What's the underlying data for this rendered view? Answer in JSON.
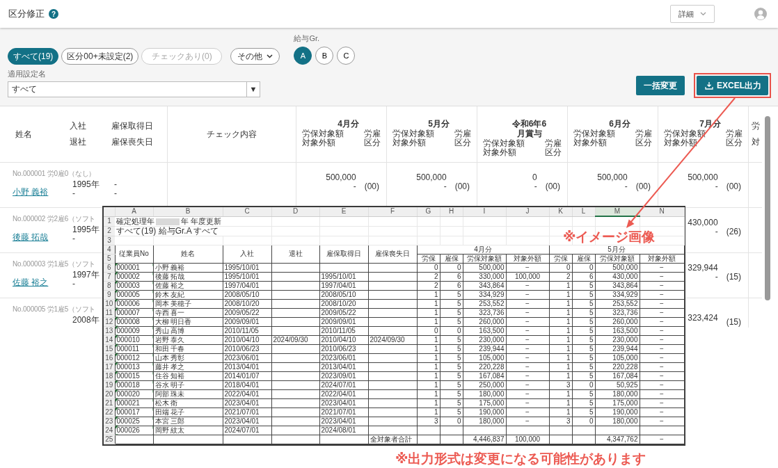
{
  "header": {
    "title": "区分修正",
    "help_icon": "?",
    "detail_menu": "詳細"
  },
  "filters": {
    "chips": [
      {
        "label": "すべて(19)",
        "selected": true,
        "disabled": false
      },
      {
        "label": "区分00+未設定(2)",
        "selected": false,
        "disabled": false
      },
      {
        "label": "チェックあり(0)",
        "selected": false,
        "disabled": true
      }
    ],
    "other_menu": "その他",
    "group_label": "給与Gr.",
    "groups": [
      {
        "label": "A",
        "selected": true
      },
      {
        "label": "B",
        "selected": false
      },
      {
        "label": "C",
        "selected": false
      }
    ]
  },
  "setting": {
    "label": "適用設定名",
    "value": "すべて",
    "arrow": "▼"
  },
  "actions": [
    {
      "label": "一括変更",
      "highlighted": false
    },
    {
      "label": "EXCEL出力",
      "highlighted": true
    }
  ],
  "table": {
    "columns": [
      {
        "kind": "plain",
        "lines": [
          "姓名"
        ]
      },
      {
        "kind": "plain",
        "lines": [
          "入社",
          "退社"
        ]
      },
      {
        "kind": "plain",
        "lines": [
          "雇保取得日",
          "雇保喪失日"
        ]
      },
      {
        "kind": "center",
        "lines": [
          "チェック内容"
        ]
      },
      {
        "kind": "month",
        "lines": [
          "4月分"
        ],
        "left": [
          "労保対象額",
          "対象外額"
        ],
        "right": [
          "労雇",
          "区分"
        ]
      },
      {
        "kind": "month",
        "lines": [
          "5月分"
        ],
        "left": [
          "労保対象額",
          "対象外額"
        ],
        "right": [
          "労雇",
          "区分"
        ]
      },
      {
        "kind": "month",
        "lines": [
          "令和6年6",
          "月賞与"
        ],
        "left": [
          "労保対象額",
          "対象外額"
        ],
        "right": [
          "労雇",
          "区分"
        ]
      },
      {
        "kind": "month",
        "lines": [
          "6月分"
        ],
        "left": [
          "労保対象額",
          "対象外額"
        ],
        "right": [
          "労雇",
          "区分"
        ]
      },
      {
        "kind": "month",
        "lines": [
          "7月分"
        ],
        "left": [
          "労保対象額",
          "対象外額"
        ],
        "right": [
          "労雇",
          "区分"
        ]
      },
      {
        "kind": "partial",
        "lines": [
          "労",
          "対"
        ]
      }
    ],
    "rows": [
      {
        "kind": "full",
        "number": "No.000001 労0雇0（なし）",
        "name": "小野 義裕",
        "joined": [
          "1995年",
          "-"
        ],
        "insured": [
          "-",
          "-"
        ],
        "months": [
          {
            "amount": "500,000",
            "excluded": "-",
            "code": "(00)"
          },
          {
            "amount": "500,000",
            "excluded": "-",
            "code": "(00)"
          },
          {
            "amount": "0",
            "excluded": "-",
            "code": "(00)"
          },
          {
            "amount": "500,000",
            "excluded": "-",
            "code": "(00)"
          },
          {
            "amount": "500,000",
            "excluded": "-",
            "code": "(00)"
          }
        ]
      },
      {
        "kind": "covered",
        "number": "No.000002 労2雇6（ソフト",
        "name": "後藤 拓哉",
        "joined": [
          "1995年",
          "-"
        ],
        "last_month": {
          "amount": "430,000",
          "excluded": "-",
          "code": "(26)"
        }
      },
      {
        "kind": "covered",
        "number": "No.000003 労1雇5（ソフト",
        "name": "佐藤 裕之",
        "joined": [
          "1997年",
          "-"
        ],
        "last_month": {
          "amount": "329,944",
          "excluded": "-",
          "code": "(15)"
        }
      },
      {
        "kind": "covered",
        "number": "No.000005 労1雇5（ソフト",
        "joined": [
          "2008年"
        ],
        "last_month": {
          "amount": "323,424",
          "code": "(15)"
        }
      }
    ]
  },
  "excel_preview": {
    "column_letters": [
      {
        "label": "A",
        "selected": false
      },
      {
        "label": "B",
        "selected": false
      },
      {
        "label": "C",
        "selected": false
      },
      {
        "label": "D",
        "selected": false
      },
      {
        "label": "E",
        "selected": false
      },
      {
        "label": "F",
        "selected": false
      },
      {
        "label": "G",
        "selected": false
      },
      {
        "label": "H",
        "selected": false
      },
      {
        "label": "I",
        "selected": false
      },
      {
        "label": "J",
        "selected": false
      },
      {
        "label": "K",
        "selected": false
      },
      {
        "label": "L",
        "selected": false
      },
      {
        "label": "M",
        "selected": true
      },
      {
        "label": "N",
        "selected": false
      }
    ],
    "row_numbers": [
      "1",
      "2",
      "3",
      "4",
      "5",
      "6",
      "7",
      "8",
      "9",
      "10",
      "11",
      "12",
      "13",
      "14",
      "15",
      "16",
      "17",
      "18",
      "19",
      "20",
      "21",
      "22",
      "23",
      "24",
      "25"
    ],
    "title_row": [
      "確定処理年",
      "年 年度更新"
    ],
    "filter_row": "すべて(19) 給与Gr.A すべて",
    "headers": [
      "従業員No",
      "姓名",
      "入社",
      "退社",
      "雇保取得日",
      "雇保喪失日"
    ],
    "months": [
      {
        "label": "4月分",
        "subheaders": [
          "労保",
          "雇保",
          "労保対象額",
          "対象外額"
        ]
      },
      {
        "label": "5月分",
        "subheaders": [
          "労保",
          "雇保",
          "労保対象額",
          "対象外額"
        ]
      }
    ],
    "rows": [
      [
        "000001",
        "小野 義裕",
        "1995/10/01",
        null,
        null,
        null,
        "0",
        "0",
        "500,000",
        "−",
        "0",
        "0",
        "500,000",
        "−"
      ],
      [
        "000002",
        "後藤 拓哉",
        "1995/10/01",
        null,
        "1995/10/01",
        null,
        "2",
        "6",
        "330,000",
        "100,000",
        "2",
        "6",
        "430,000",
        "−"
      ],
      [
        "000003",
        "佐藤 裕之",
        "1997/04/01",
        null,
        "1997/04/01",
        null,
        "2",
        "6",
        "343,864",
        "−",
        "1",
        "5",
        "343,864",
        "−"
      ],
      [
        "000005",
        "鈴木 友紀",
        "2008/05/10",
        null,
        "2008/05/10",
        null,
        "1",
        "5",
        "334,929",
        "−",
        "1",
        "5",
        "334,929",
        "−"
      ],
      [
        "000006",
        "岡本 美穂子",
        "2008/10/20",
        null,
        "2008/10/20",
        null,
        "1",
        "5",
        "253,552",
        "−",
        "1",
        "5",
        "253,552",
        "−"
      ],
      [
        "000007",
        "寺西 喜一",
        "2009/05/22",
        null,
        "2009/05/22",
        null,
        "1",
        "5",
        "323,736",
        "−",
        "1",
        "5",
        "323,736",
        "−"
      ],
      [
        "000008",
        "大柳 明日香",
        "2009/09/01",
        null,
        "2009/09/01",
        null,
        "1",
        "5",
        "260,000",
        "−",
        "1",
        "5",
        "260,000",
        "−"
      ],
      [
        "000009",
        "秀山 高博",
        "2010/11/05",
        null,
        "2010/11/05",
        null,
        "0",
        "0",
        "163,500",
        "−",
        "1",
        "5",
        "163,500",
        "−"
      ],
      [
        "000010",
        "岩野 泰久",
        "2010/04/10",
        "2024/09/30",
        "2010/04/10",
        "2024/09/30",
        "1",
        "5",
        "230,000",
        "−",
        "1",
        "5",
        "230,000",
        "−"
      ],
      [
        "000011",
        "和田 千春",
        "2010/06/23",
        null,
        "2010/06/23",
        null,
        "1",
        "5",
        "239,944",
        "−",
        "1",
        "5",
        "239,944",
        "−"
      ],
      [
        "000012",
        "山本 秀彰",
        "2023/06/01",
        null,
        "2023/06/01",
        null,
        "1",
        "5",
        "105,000",
        "−",
        "1",
        "5",
        "105,000",
        "−"
      ],
      [
        "000013",
        "藤井 孝之",
        "2013/04/01",
        null,
        "2013/04/01",
        null,
        "1",
        "5",
        "220,228",
        "−",
        "1",
        "5",
        "220,228",
        "−"
      ],
      [
        "000015",
        "住谷 知裕",
        "2014/01/07",
        null,
        "2023/09/01",
        null,
        "1",
        "5",
        "167,084",
        "−",
        "1",
        "5",
        "167,084",
        "−"
      ],
      [
        "000018",
        "谷水 明子",
        "2018/04/01",
        null,
        "2024/07/01",
        null,
        "1",
        "5",
        "250,000",
        "−",
        "3",
        "0",
        "50,925",
        "−"
      ],
      [
        "000020",
        "阿部 珠未",
        "2022/04/01",
        null,
        "2022/04/01",
        null,
        "1",
        "5",
        "180,000",
        "−",
        "1",
        "5",
        "180,000",
        "−"
      ],
      [
        "000021",
        "松木 衛",
        "2023/04/01",
        null,
        "2023/04/01",
        null,
        "1",
        "5",
        "175,000",
        "−",
        "1",
        "5",
        "175,000",
        "−"
      ],
      [
        "000017",
        "田端 花子",
        "2021/07/01",
        null,
        "2021/07/01",
        null,
        "1",
        "5",
        "190,000",
        "−",
        "1",
        "5",
        "190,000",
        "−"
      ],
      [
        "000025",
        "本宮 三郎",
        "2023/04/01",
        null,
        "2023/04/01",
        null,
        "3",
        "0",
        "180,000",
        "−",
        "3",
        "0",
        "180,000",
        "−"
      ],
      [
        "000026",
        "岡野 紋太",
        "2024/07/01",
        null,
        "2024/08/01",
        null,
        null,
        null,
        null,
        null,
        null,
        null,
        null,
        null
      ]
    ],
    "total": {
      "label": "全対象者合計",
      "cells": [
        null,
        null,
        "4,446,837",
        "100,000",
        null,
        null,
        "4,347,762",
        "−"
      ]
    }
  },
  "notes": {
    "image_note": "※イメージ画像",
    "format_note": "※出力形式は変更になる可能性があります"
  }
}
